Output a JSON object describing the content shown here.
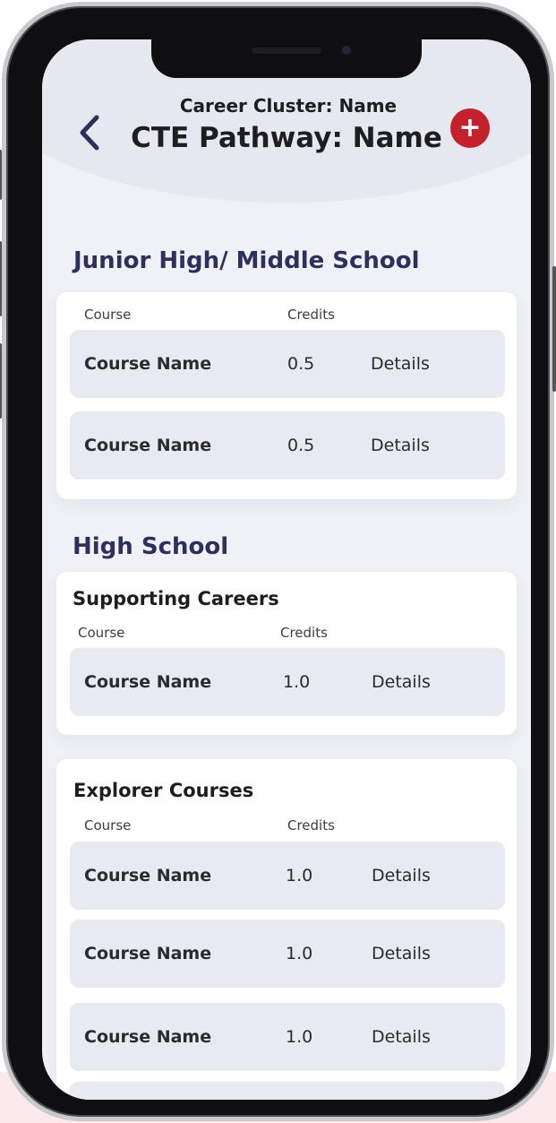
{
  "header": {
    "subtitle": "Career Cluster: Name",
    "title": "CTE Pathway: Name",
    "back_icon": "chevron-left-icon",
    "add_icon": "plus-icon",
    "add_symbol": "+",
    "accent_color": "#c4212c",
    "heading_color": "#2d2f5c"
  },
  "sections": {
    "junior": {
      "heading": "Junior High/ Middle School",
      "col_course": "Course",
      "col_credits": "Credits",
      "rows": [
        {
          "name": "Course Name",
          "credits": "0.5",
          "action": "Details"
        },
        {
          "name": "Course Name",
          "credits": "0.5",
          "action": "Details"
        }
      ]
    },
    "high_school": {
      "heading": "High School",
      "supporting": {
        "title": "Supporting Careers",
        "col_course": "Course",
        "col_credits": "Credits",
        "rows": [
          {
            "name": "Course Name",
            "credits": "1.0",
            "action": "Details"
          }
        ]
      },
      "explorer": {
        "title": "Explorer Courses",
        "col_course": "Course",
        "col_credits": "Credits",
        "rows": [
          {
            "name": "Course Name",
            "credits": "1.0",
            "action": "Details"
          },
          {
            "name": "Course Name",
            "credits": "1.0",
            "action": "Details"
          },
          {
            "name": "Course Name",
            "credits": "1.0",
            "action": "Details"
          }
        ]
      }
    }
  }
}
